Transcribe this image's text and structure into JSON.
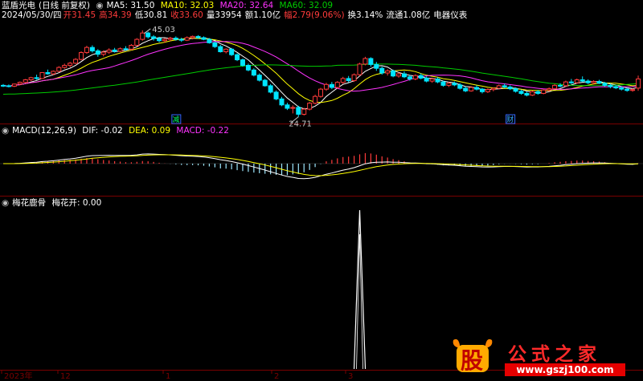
{
  "colors": {
    "bg": "#000000",
    "up": "#ff3b3b",
    "down": "#00e5ff",
    "ma5": "#ffffff",
    "ma10": "#ffff00",
    "ma20": "#ff33ff",
    "ma60": "#00cc00",
    "dif": "#ffffff",
    "dea": "#ffff00",
    "grid": "#7a0000",
    "label": "#c8c8c8"
  },
  "header": {
    "stock_name": "蓝盾光电",
    "period": "(日线 前复权)",
    "ma5": "MA5: 31.50",
    "ma10": "MA10: 32.03",
    "ma20": "MA20: 32.64",
    "ma60": "MA60: 32.09",
    "date": "2024/05/30/四",
    "open": "开31.45",
    "high": "高34.39",
    "low": "低30.81",
    "close": "收33.60",
    "volume": "量33954",
    "amount": "额1.10亿",
    "change": "幅2.79(9.06%)",
    "turnover": "换3.14%",
    "float_cap": "流通1.08亿",
    "industry": "电器仪表"
  },
  "macd_header": {
    "title": "MACD(12,26,9)",
    "dif": "DIF: -0.02",
    "dea": "DEA: 0.09",
    "macd": "MACD: -0.22"
  },
  "ind_header": {
    "title": "梅花鹿骨",
    "value": "梅花开: 0.00"
  },
  "axis_labels": [
    "2023年",
    "12",
    "1",
    "2",
    "3"
  ],
  "markers": {
    "m1": "减",
    "m2": "财"
  },
  "watermark": {
    "text": "公式之家",
    "url": "www.gszj100.com",
    "logo": "股"
  },
  "chart_data": [
    {
      "type": "candlestick",
      "title": "蓝盾光电 (日线 前复权)",
      "annotations": [
        {
          "label": "45.03",
          "type": "max"
        },
        {
          "label": "24.71",
          "type": "min"
        }
      ],
      "ohlc": [
        [
          32.1,
          32.4,
          31.7,
          32
        ],
        [
          32,
          32.3,
          31.6,
          31.9
        ],
        [
          31.9,
          32.5,
          31.7,
          32.4
        ],
        [
          32.4,
          33,
          32.1,
          32.8
        ],
        [
          32.8,
          33.6,
          32.6,
          33.4
        ],
        [
          33.4,
          34.1,
          33.1,
          33.9
        ],
        [
          33.9,
          34.6,
          33.4,
          33.7
        ],
        [
          33.7,
          35.2,
          33.6,
          35.1
        ],
        [
          35.1,
          35.8,
          34.6,
          34.8
        ],
        [
          34.8,
          35.6,
          34.5,
          35.4
        ],
        [
          35.4,
          36.6,
          35.2,
          36.3
        ],
        [
          36.3,
          37.2,
          36,
          36.8
        ],
        [
          36.8,
          37.6,
          36.3,
          37.3
        ],
        [
          37.3,
          38.5,
          37.1,
          38.2
        ],
        [
          38.2,
          40.1,
          38,
          39.8
        ],
        [
          39.8,
          41.4,
          39.5,
          41
        ],
        [
          41,
          41.5,
          39.8,
          40.2
        ],
        [
          40.2,
          40.6,
          38.8,
          39.4
        ],
        [
          39.4,
          40.3,
          38.9,
          39.9
        ],
        [
          39.9,
          40.8,
          39.5,
          40.4
        ],
        [
          40.4,
          40.9,
          39.8,
          40.1
        ],
        [
          40.1,
          41,
          39.9,
          40.7
        ],
        [
          40.7,
          41.3,
          40.2,
          40.6
        ],
        [
          40.6,
          41.8,
          40.3,
          41.5
        ],
        [
          41.5,
          43.2,
          41.3,
          42.9
        ],
        [
          42.9,
          45.03,
          42.6,
          44.4
        ],
        [
          44.4,
          44.7,
          43.1,
          43.5
        ],
        [
          43.5,
          43.9,
          42.6,
          43.1
        ],
        [
          43.1,
          43.5,
          42.2,
          42.6
        ],
        [
          42.6,
          43.2,
          42.1,
          42.9
        ],
        [
          42.9,
          43.5,
          42.5,
          43.2
        ],
        [
          43.2,
          43.6,
          42.6,
          42.9
        ],
        [
          42.9,
          43.3,
          42.3,
          42.7
        ],
        [
          42.7,
          43.6,
          42.5,
          43.3
        ],
        [
          43.3,
          43.8,
          42.9,
          43.6
        ],
        [
          43.6,
          43.9,
          43,
          43.3
        ],
        [
          43.3,
          43.6,
          42.7,
          42.9
        ],
        [
          42.9,
          43.2,
          41.9,
          42.1
        ],
        [
          42.1,
          42.4,
          40.9,
          41.2
        ],
        [
          41.2,
          41.6,
          39.8,
          40
        ],
        [
          40,
          40.8,
          39.6,
          40.6
        ],
        [
          40.6,
          40.9,
          39,
          39.3
        ],
        [
          39.3,
          39.6,
          37.8,
          38.1
        ],
        [
          38.1,
          38.4,
          36.5,
          36.8
        ],
        [
          36.8,
          37.2,
          35.4,
          35.7
        ],
        [
          35.7,
          36.1,
          34.2,
          34.5
        ],
        [
          34.5,
          34.9,
          33,
          33.3
        ],
        [
          33.3,
          33.6,
          31.8,
          32
        ],
        [
          32,
          32.4,
          30.2,
          30.5
        ],
        [
          30.5,
          30.9,
          28.6,
          28.9
        ],
        [
          28.9,
          29.4,
          27.2,
          27.5
        ],
        [
          27.5,
          28,
          26.3,
          26.7
        ],
        [
          26.7,
          27.4,
          25.5,
          26.9
        ],
        [
          26.9,
          27.3,
          24.71,
          25.3
        ],
        [
          25.3,
          26.8,
          25,
          26.5
        ],
        [
          26.5,
          28.2,
          26.2,
          27.9
        ],
        [
          27.9,
          29.9,
          27.6,
          29.5
        ],
        [
          29.5,
          31.5,
          29.2,
          31.2
        ],
        [
          31.2,
          32.7,
          30.8,
          32.3
        ],
        [
          32.3,
          32.9,
          31.2,
          31.6
        ],
        [
          31.6,
          33.1,
          31.3,
          32.8
        ],
        [
          32.8,
          34.1,
          32.4,
          33.7
        ],
        [
          33.7,
          34.3,
          32.8,
          33.2
        ],
        [
          33.2,
          34.9,
          32.9,
          34.6
        ],
        [
          34.6,
          37.4,
          34.3,
          37.1
        ],
        [
          37.1,
          38.8,
          36.8,
          38.4
        ],
        [
          38.4,
          38.7,
          36.5,
          37
        ],
        [
          37,
          37.6,
          35.5,
          36.1
        ],
        [
          36.1,
          36.5,
          34.6,
          35
        ],
        [
          35,
          35.9,
          34.4,
          35.5
        ],
        [
          35.5,
          35.8,
          34,
          34.3
        ],
        [
          34.3,
          35.1,
          33.9,
          34.8
        ],
        [
          34.8,
          35.4,
          33.8,
          34.1
        ],
        [
          34.1,
          34.5,
          33.2,
          33.6
        ],
        [
          33.6,
          34.7,
          33.3,
          34.4
        ],
        [
          34.4,
          34.9,
          33.5,
          33.8
        ],
        [
          33.8,
          34.2,
          32.8,
          33.1
        ],
        [
          33.1,
          33.9,
          32.7,
          33.6
        ],
        [
          33.6,
          34,
          32.6,
          32.9
        ],
        [
          32.9,
          33.2,
          31.8,
          32.1
        ],
        [
          32.1,
          32.9,
          31.7,
          32.6
        ],
        [
          32.6,
          33,
          31.9,
          32.2
        ],
        [
          32.2,
          32.6,
          31.1,
          31.4
        ],
        [
          31.4,
          31.8,
          30.5,
          30.8
        ],
        [
          30.8,
          31.9,
          30.6,
          31.6
        ],
        [
          31.6,
          32.1,
          30.9,
          31.2
        ],
        [
          31.2,
          31.5,
          30.2,
          30.6
        ],
        [
          30.6,
          31.4,
          30.3,
          31.1
        ],
        [
          31.1,
          31.6,
          30.7,
          31.4
        ],
        [
          31.4,
          32.3,
          31.2,
          32
        ],
        [
          32,
          32.5,
          31.4,
          31.7
        ],
        [
          31.7,
          32.1,
          31,
          31.3
        ],
        [
          31.3,
          31.6,
          30.4,
          30.7
        ],
        [
          30.7,
          31.1,
          29.9,
          30.2
        ],
        [
          30.2,
          30.6,
          29.5,
          29.8
        ],
        [
          29.8,
          30.9,
          29.6,
          30.6
        ],
        [
          30.6,
          31,
          29.9,
          30.2
        ],
        [
          30.2,
          31.2,
          30,
          31
        ],
        [
          31,
          31.6,
          30.6,
          31.3
        ],
        [
          31.3,
          32.4,
          31.1,
          32.1
        ],
        [
          32.1,
          32.6,
          31.6,
          32
        ],
        [
          32,
          33.2,
          31.8,
          32.9
        ],
        [
          32.9,
          33.6,
          32.4,
          32.7
        ],
        [
          32.7,
          33.7,
          32.5,
          33.4
        ],
        [
          33.4,
          34.2,
          32.9,
          33.1
        ],
        [
          33.1,
          33.5,
          32.4,
          32.7
        ],
        [
          32.7,
          33.3,
          32.3,
          33
        ],
        [
          33,
          33.4,
          32.4,
          32.6
        ],
        [
          32.6,
          32.9,
          31.8,
          32.1
        ],
        [
          32.1,
          32.5,
          31.4,
          31.8
        ],
        [
          31.8,
          32.2,
          31.2,
          31.5
        ],
        [
          31.5,
          31.9,
          30.9,
          31.2
        ],
        [
          31.2,
          31.6,
          30.6,
          30.9
        ],
        [
          30.9,
          31.4,
          30.6,
          31.1
        ],
        [
          31.45,
          34.39,
          30.81,
          33.6
        ]
      ]
    },
    {
      "type": "bar",
      "title": "MACD(12,26,9)",
      "dif": -0.02,
      "dea": 0.09,
      "macd": -0.22
    },
    {
      "type": "line",
      "title": "梅花鹿骨",
      "series": [
        {
          "name": "梅花开",
          "values_note": "0 except a single spike of 1 near bar 64"
        }
      ],
      "spike_index": 64,
      "ylim": [
        0,
        1
      ]
    }
  ]
}
